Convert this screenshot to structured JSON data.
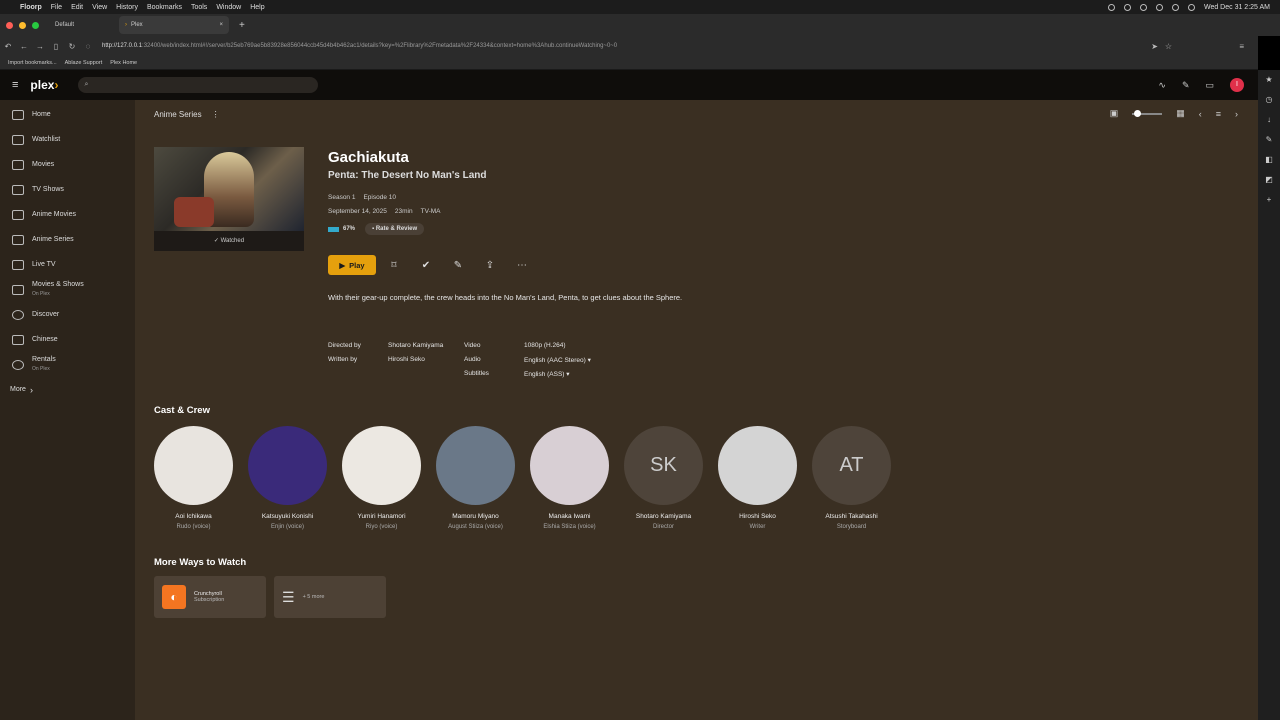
{
  "os_menubar": {
    "app": "Floorp",
    "menus": [
      "File",
      "Edit",
      "View",
      "History",
      "Bookmarks",
      "Tools",
      "Window",
      "Help"
    ],
    "clock": "Wed Dec 31  2:25 AM"
  },
  "browser": {
    "tabs": [
      {
        "label": "Default",
        "active": false
      },
      {
        "label": "Plex",
        "active": true
      }
    ],
    "url_host": "http://127.0.0.1",
    "url_rest": ":32400/web/index.html#!/server/b25eb769ae5b83928e856044ccb45d4b4b462ac1/details?key=%2Flibrary%2Fmetadata%2F24334&context=home%3Ahub.continueWatching~0~0",
    "bookmarks": [
      "Import bookmarks...",
      "Ablaze Support",
      "Plex Home"
    ]
  },
  "plex": {
    "logo": "plex",
    "search_placeholder": "",
    "avatar_initial": "I"
  },
  "sidebar": {
    "items": [
      {
        "label": "Home",
        "sub": ""
      },
      {
        "label": "Watchlist",
        "sub": ""
      },
      {
        "label": "Movies",
        "sub": ""
      },
      {
        "label": "TV Shows",
        "sub": ""
      },
      {
        "label": "Anime Movies",
        "sub": ""
      },
      {
        "label": "Anime Series",
        "sub": ""
      },
      {
        "label": "Live TV",
        "sub": ""
      },
      {
        "label": "Movies & Shows",
        "sub": "On Plex"
      },
      {
        "label": "Discover",
        "sub": ""
      },
      {
        "label": "Chinese",
        "sub": ""
      },
      {
        "label": "Rentals",
        "sub": "On Plex"
      }
    ],
    "more": "More"
  },
  "main": {
    "breadcrumb": "Anime Series",
    "poster_status": "Watched",
    "title": "Gachiakuta",
    "episode_title": "Penta: The Desert No Man's Land",
    "season": "Season 1",
    "episode": "Episode 10",
    "date": "September 14, 2025",
    "duration": "23min",
    "rating_code": "TV-MA",
    "score": "67%",
    "rate_review": "Rate & Review",
    "play": "Play",
    "summary": "With their gear-up complete, the crew heads into the No Man's Land, Penta, to get clues about the Sphere.",
    "directed_by_label": "Directed by",
    "directed_by": "Shotaro Kamiyama",
    "written_by_label": "Written by",
    "written_by": "Hiroshi Seko",
    "video_label": "Video",
    "video": "1080p (H.264)",
    "audio_label": "Audio",
    "audio": "English (AAC Stereo)",
    "subtitles_label": "Subtitles",
    "subtitles": "English (ASS)",
    "cast_title": "Cast & Crew",
    "cast": [
      {
        "name": "Aoi Ichikawa",
        "role": "Rudo (voice)",
        "initials": "",
        "color": "#e8e4df"
      },
      {
        "name": "Katsuyuki Konishi",
        "role": "Enjin (voice)",
        "initials": "",
        "color": "#3a2a7a"
      },
      {
        "name": "Yumiri Hanamori",
        "role": "Riyo (voice)",
        "initials": "",
        "color": "#ece8e2"
      },
      {
        "name": "Mamoru Miyano",
        "role": "August Stiiza (voice)",
        "initials": "",
        "color": "#6a7888"
      },
      {
        "name": "Manaka Iwami",
        "role": "Elshia Stiiza (voice)",
        "initials": "",
        "color": "#d8cfd4"
      },
      {
        "name": "Shotaro Kamiyama",
        "role": "Director",
        "initials": "SK",
        "color": "#4e443a"
      },
      {
        "name": "Hiroshi Seko",
        "role": "Writer",
        "initials": "",
        "color": "#d4d4d4"
      },
      {
        "name": "Atsushi Takahashi",
        "role": "Storyboard",
        "initials": "AT",
        "color": "#4e443a"
      }
    ],
    "ways_title": "More Ways to Watch",
    "ways": [
      {
        "name": "Crunchyroll",
        "sub": "Subscription"
      },
      {
        "name": "+ 5 more",
        "sub": ""
      }
    ]
  }
}
